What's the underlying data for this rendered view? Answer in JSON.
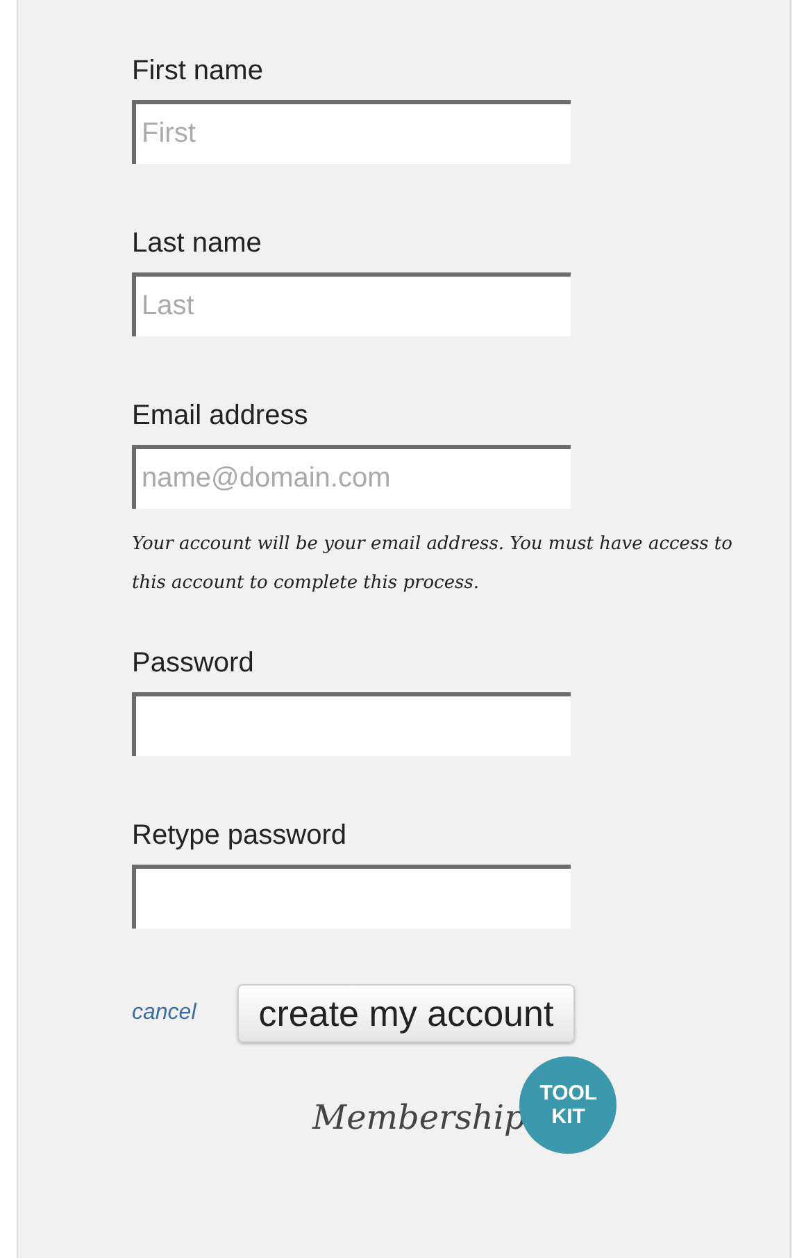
{
  "fields": [
    {
      "label": "First name",
      "placeholder": "First"
    },
    {
      "label": "Last name",
      "placeholder": "Last"
    },
    {
      "label": "Email address",
      "placeholder": "name@domain.com",
      "note": "Your account will be your email address. You must have access to this account to complete this process."
    },
    {
      "label": "Password"
    },
    {
      "label": "Retype password"
    }
  ],
  "actions": {
    "cancel": "cancel",
    "submit": "create my account"
  },
  "logo": {
    "script": "Membership",
    "badge": [
      "TOOL",
      "KIT"
    ]
  }
}
